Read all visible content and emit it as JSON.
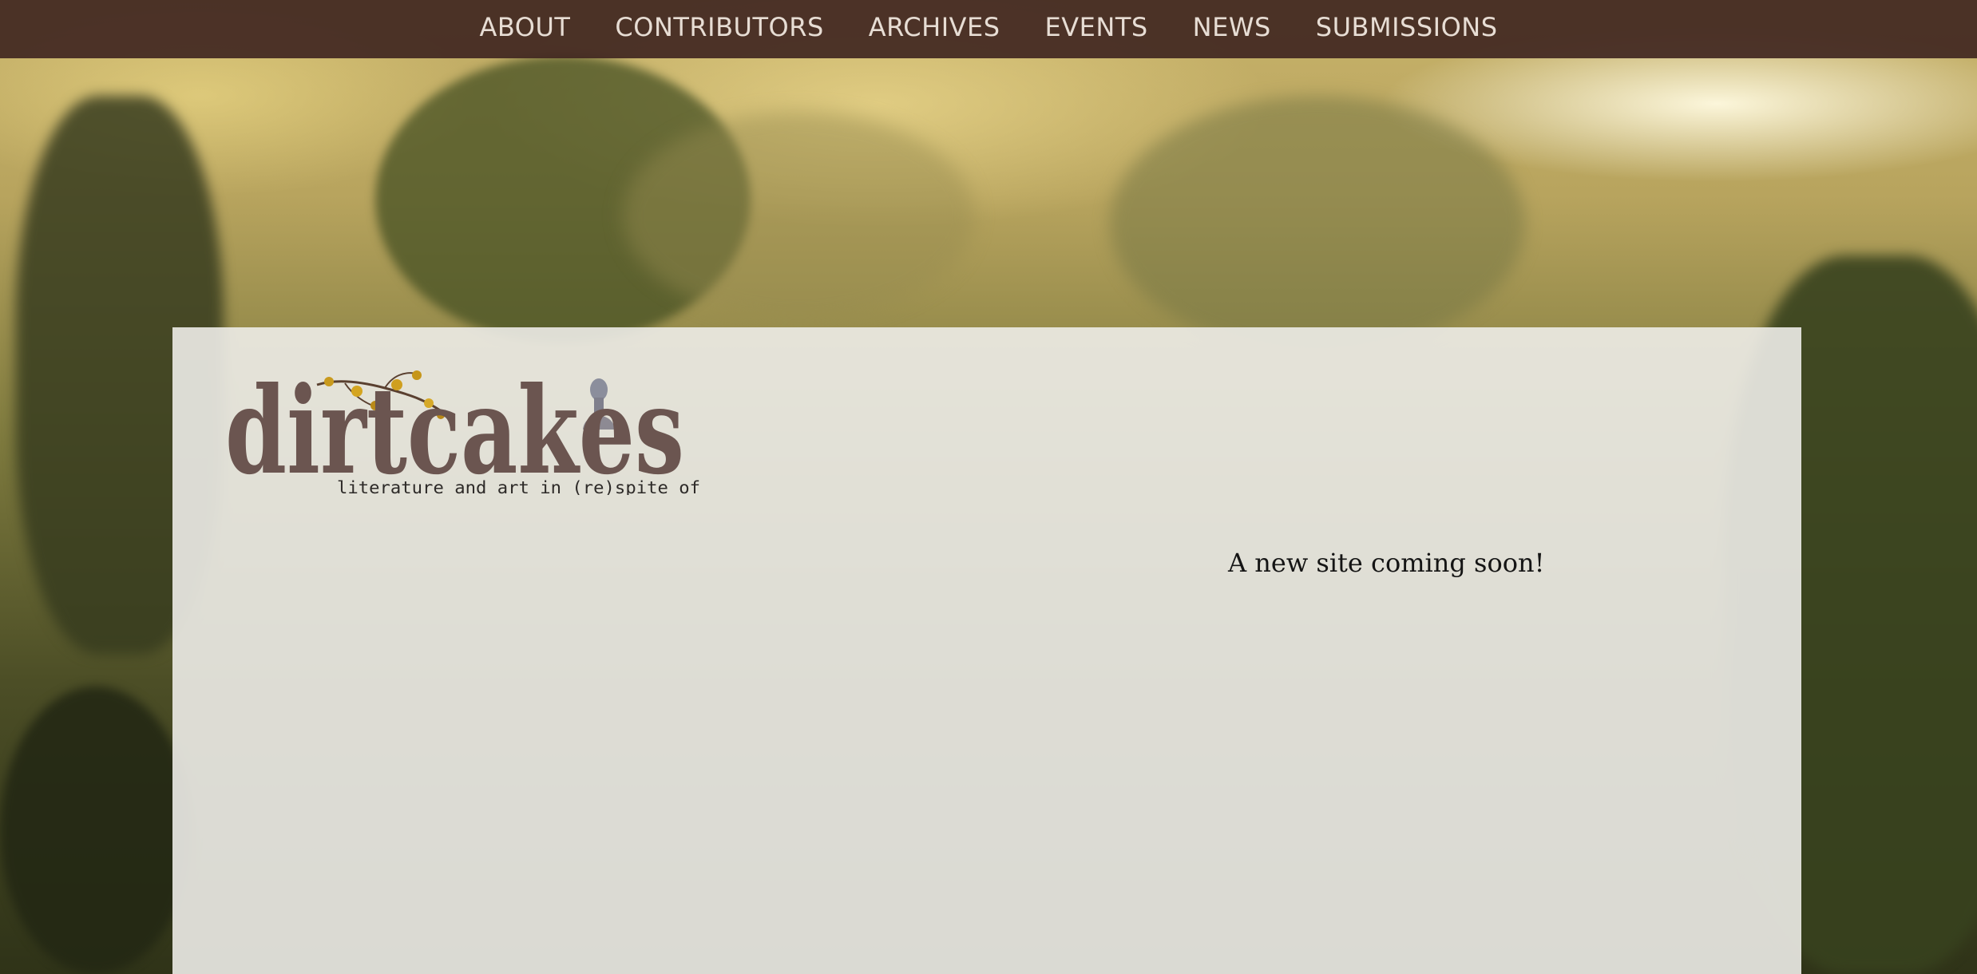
{
  "nav": {
    "items": [
      {
        "label": "ABOUT"
      },
      {
        "label": "CONTRIBUTORS"
      },
      {
        "label": "ARCHIVES"
      },
      {
        "label": "EVENTS"
      },
      {
        "label": "NEWS"
      },
      {
        "label": "SUBMISSIONS"
      }
    ]
  },
  "logo": {
    "wordmark": "dirtcakes",
    "tagline": "literature and art in (re)spite of"
  },
  "main": {
    "message": "A new site coming soon!"
  },
  "colors": {
    "nav_bg": "#42281f",
    "nav_text": "#e7ddd4",
    "panel_bg": "#edece8",
    "logo_text": "#6b5550"
  }
}
